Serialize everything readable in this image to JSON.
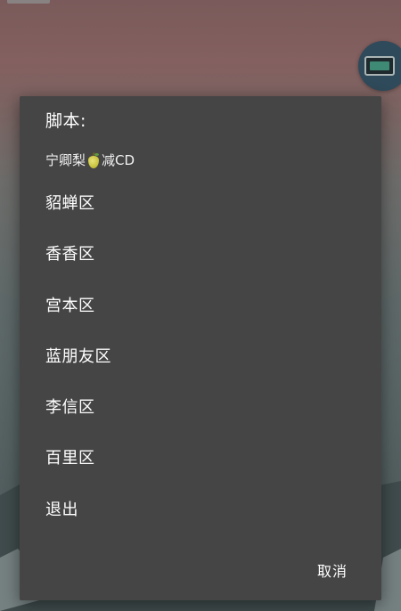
{
  "dialog": {
    "title": "脚本:",
    "subtitle_prefix": "宁卿梨",
    "subtitle_icon": "pear-icon",
    "subtitle_suffix": "减CD",
    "options": [
      {
        "label": "貂蝉区"
      },
      {
        "label": "香香区"
      },
      {
        "label": "宫本区"
      },
      {
        "label": "蓝朋友区"
      },
      {
        "label": "李信区"
      },
      {
        "label": "百里区"
      },
      {
        "label": "退出"
      }
    ],
    "cancel_label": "取消"
  },
  "floating_bubble": {
    "icon": "screen-icon"
  },
  "colors": {
    "dialog_background": "#454545",
    "text": "#ffffff",
    "bubble": "#2f4a5a"
  }
}
